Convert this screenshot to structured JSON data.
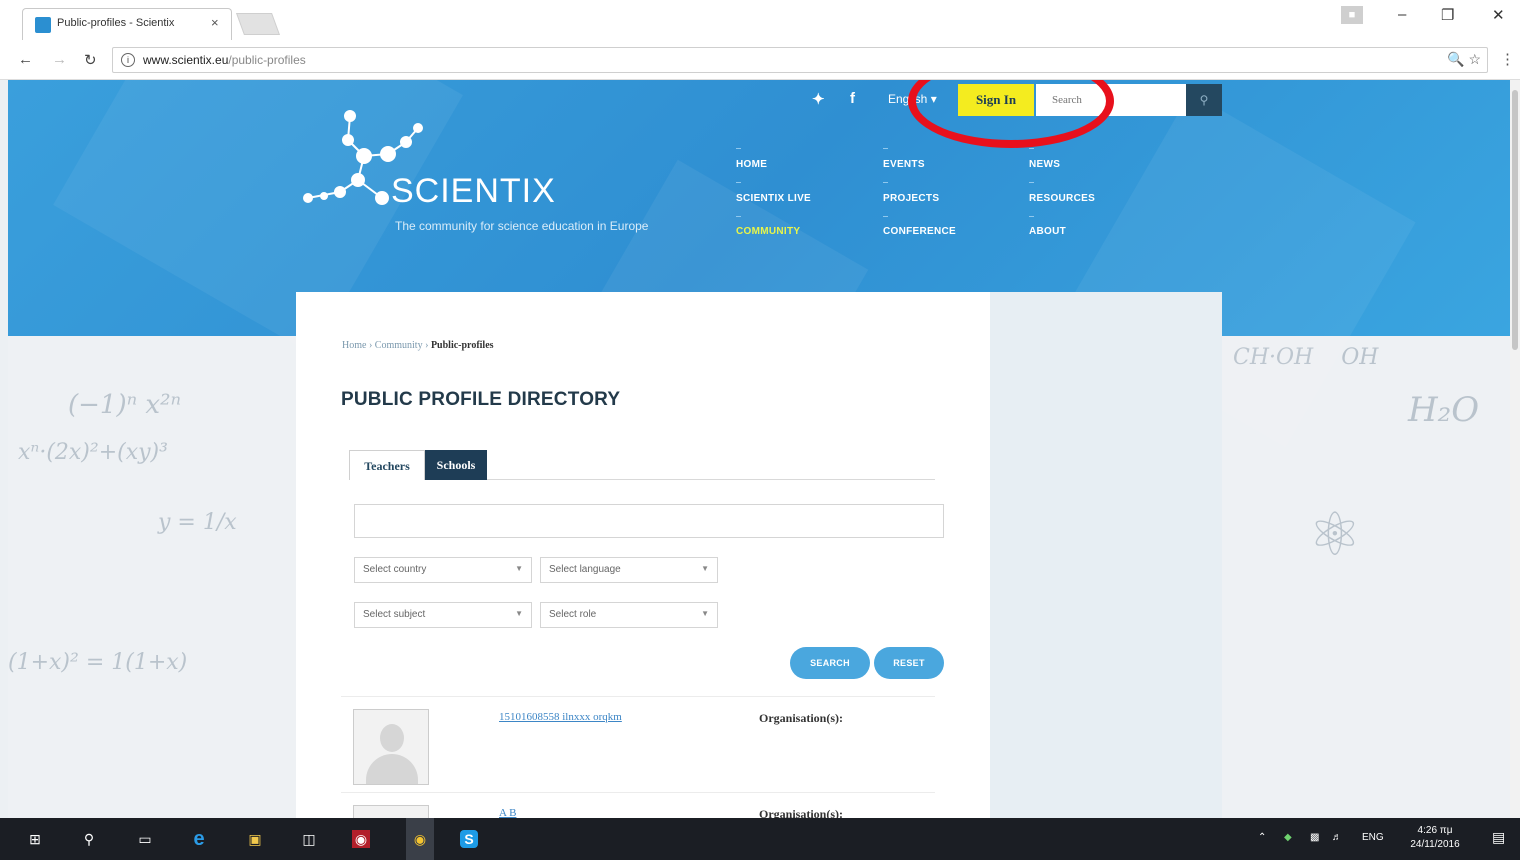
{
  "browser": {
    "tab_title": "Public-profiles - Scientix",
    "tab_close": "×",
    "url_host": "www.scientix.eu",
    "url_path": "/public-profiles",
    "icons": [
      "back-icon",
      "forward-icon",
      "reload-icon",
      "info-icon",
      "zoom-icon",
      "star-icon",
      "menu-icon"
    ]
  },
  "header": {
    "logo_text": "SCIENTIX",
    "tagline": "The community for science education in Europe",
    "language": "English",
    "signin_label": "Sign In",
    "search_placeholder": "Search",
    "nav": [
      {
        "label": "HOME"
      },
      {
        "label": "EVENTS"
      },
      {
        "label": "NEWS"
      },
      {
        "label": "SCIENTIX LIVE"
      },
      {
        "label": "PROJECTS"
      },
      {
        "label": "RESOURCES"
      },
      {
        "label": "COMMUNITY",
        "active": true
      },
      {
        "label": "CONFERENCE"
      },
      {
        "label": "ABOUT"
      }
    ],
    "accent": "#f4ec1f",
    "brand_blue": "#3a9fdc"
  },
  "main": {
    "breadcrumb": {
      "home": "Home",
      "sep1": " › ",
      "community": "Community",
      "sep2": " › ",
      "current": "Public-profiles"
    },
    "title": "PUBLIC PROFILE DIRECTORY",
    "tabs": [
      {
        "label": "Teachers"
      },
      {
        "label": "Schools"
      }
    ],
    "keyword_value": "",
    "selects": {
      "country": "Select country",
      "language": "Select language",
      "subject": "Select subject",
      "role": "Select role"
    },
    "search_button": "SEARCH",
    "reset_button": "RESET",
    "results": [
      {
        "name": "15101608558 ilnxxx orqkm",
        "org_label": "Organisation(s):"
      },
      {
        "name": "A B",
        "org_label": "Organisation(s):"
      }
    ]
  },
  "taskbar": {
    "lang": "ENG",
    "time": "4:26 πμ",
    "date": "24/11/2016"
  }
}
